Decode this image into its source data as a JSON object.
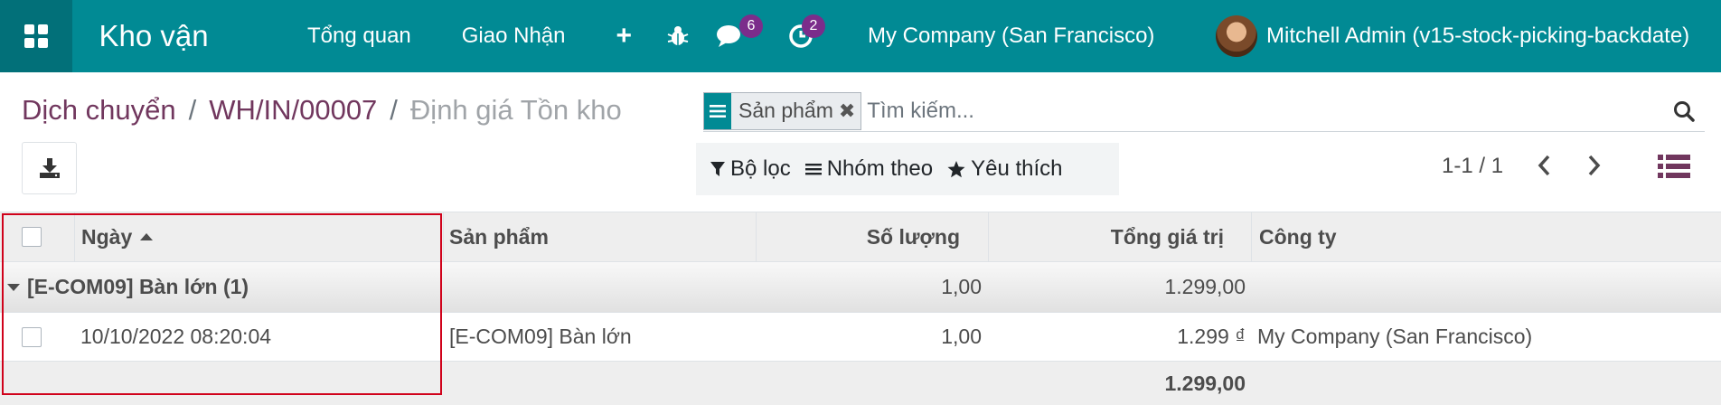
{
  "navbar": {
    "app_name": "Kho vận",
    "menu": [
      "Tổng quan",
      "Giao Nhận"
    ],
    "plus_icon": "plus-icon",
    "chat_badge": "6",
    "activity_badge": "2",
    "company": "My Company (San Francisco)",
    "user": "Mitchell Admin (v15-stock-picking-backdate)",
    "color": "#018a94"
  },
  "breadcrumb": {
    "items": [
      "Dịch chuyển",
      "WH/IN/00007"
    ],
    "separator": "/",
    "active": "Định giá Tồn kho"
  },
  "search": {
    "facet_value": "Sản phẩm",
    "placeholder": "Tìm kiếm..."
  },
  "filters": {
    "filter_label": "Bộ lọc",
    "group_label": "Nhóm theo",
    "favorite_label": "Yêu thích"
  },
  "pager": {
    "value": "1-1 / 1"
  },
  "table": {
    "columns": {
      "date": "Ngày",
      "product": "Sản phẩm",
      "quantity": "Số lượng",
      "total_value": "Tổng giá trị",
      "company": "Công ty"
    },
    "group": {
      "label": "[E-COM09] Bàn lớn (1)",
      "quantity": "1,00",
      "total_value": "1.299,00"
    },
    "row": {
      "date": "10/10/2022 08:20:04",
      "product": "[E-COM09] Bàn lớn",
      "quantity": "1,00",
      "total_value": "1.299 ₫",
      "company": "My Company (San Francisco)"
    },
    "footer": {
      "total_value": "1.299,00"
    }
  }
}
